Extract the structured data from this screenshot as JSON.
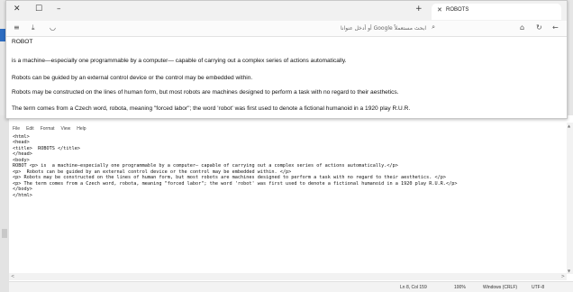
{
  "browser": {
    "tab_title": "ROBOTS",
    "url_placeholder": "ابحث مستعملاً Google أو أدخل عنوانا",
    "page": {
      "heading": "ROBOT",
      "paragraphs": [
        "is a machine—especially one programmable by a computer— capable of carrying out a complex series of actions automatically.",
        "Robots can be guided by an external control device or the control may be embedded within.",
        "Robots may be constructed on the lines of human form, but most robots are machines designed to perform a task with no regard to their aesthetics.",
        "The term comes from a Czech word, robota, meaning \"forced labor\"; the word 'robot' was first used to denote a fictional humanoid in a 1920 play R.U.R."
      ]
    }
  },
  "notepad": {
    "menu": [
      "File",
      "Edit",
      "Format",
      "View",
      "Help"
    ],
    "lines": [
      "<html>",
      "<head>",
      "<title>  ROBOTS </title>",
      "</head>",
      "<body>",
      "ROBOT <p> is  a machine—especially one programmable by a computer— capable of carrying out a complex series of actions automatically.</p>",
      "<p>  Robots can be guided by an external control device or the control may be embedded within. </p>",
      "<p> Robots may be constructed on the lines of human form, but most robots are machines designed to perform a task with no regard to their aesthetics. </p>",
      "<p> The term comes from a Czech word, robota, meaning \"forced labor\"; the word 'robot' was first used to denote a fictional humanoid in a 1920 play R.U.R.</p>",
      "",
      "</body>",
      "</html>"
    ],
    "status": {
      "position": "Ln 8, Col 159",
      "zoom": "100%",
      "line_ending": "Windows (CRLF)",
      "encoding": "UTF-8"
    }
  }
}
